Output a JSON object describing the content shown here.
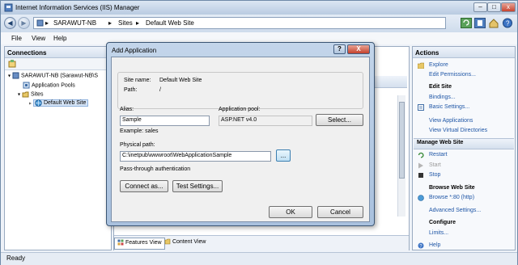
{
  "window": {
    "title": "Internet Information Services (IIS) Manager"
  },
  "breadcrumb": {
    "items": [
      "SARAWUT-NB",
      "Sites",
      "Default Web Site"
    ],
    "separator": "▸"
  },
  "menu": {
    "items": [
      "File",
      "View",
      "Help"
    ]
  },
  "connections": {
    "header": "Connections",
    "tree": {
      "server": "SARAWUT-NB (Sarawut-NB\\S",
      "app_pools": "Application Pools",
      "sites": "Sites",
      "site": "Default Web Site"
    }
  },
  "center": {
    "features_view": "Features View",
    "content_view": "Content View"
  },
  "actions": {
    "header": "Actions",
    "explore": "Explore",
    "edit_permissions": "Edit Permissions...",
    "edit_site_header": "Edit Site",
    "bindings": "Bindings...",
    "basic_settings": "Basic Settings...",
    "view_applications": "View Applications",
    "view_virtual_dirs": "View Virtual Directories",
    "manage_header": "Manage Web Site",
    "restart": "Restart",
    "start": "Start",
    "stop": "Stop",
    "browse_header": "Browse Web Site",
    "browse_80": "Browse *:80 (http)",
    "advanced_settings": "Advanced Settings...",
    "configure_header": "Configure",
    "limits": "Limits...",
    "help": "Help"
  },
  "status": {
    "text": "Ready"
  },
  "dialog": {
    "title": "Add Application",
    "site_name_label": "Site name:",
    "site_name_value": "Default Web Site",
    "path_label": "Path:",
    "path_value": "/",
    "alias_label": "Alias:",
    "alias_value": "Sample",
    "app_pool_label": "Application pool:",
    "app_pool_value": "ASP.NET v4.0",
    "select_button": "Select...",
    "example": "Example: sales",
    "physical_path_label": "Physical path:",
    "physical_path_value": "C:\\inetpub\\wwwroot\\WebApplicationSample",
    "browse_button": "...",
    "passthrough": "Pass-through authentication",
    "connect_as_button": "Connect as...",
    "test_settings_button": "Test Settings...",
    "ok_button": "OK",
    "cancel_button": "Cancel",
    "help_button": "?",
    "close_button": "X"
  }
}
